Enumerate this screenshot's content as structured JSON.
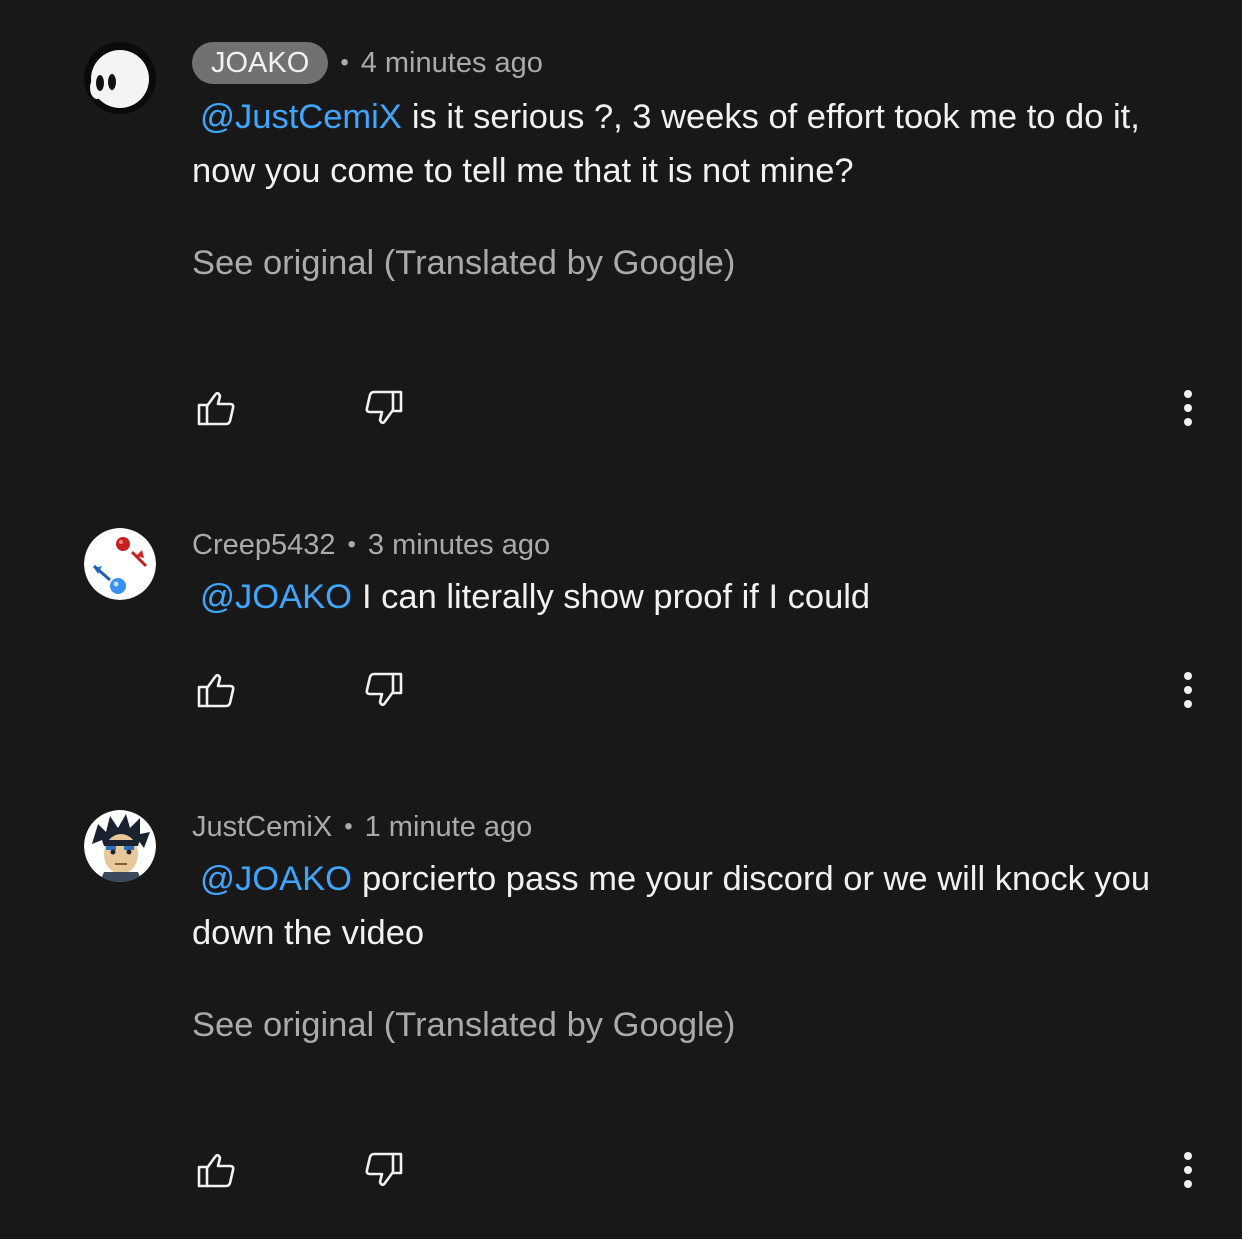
{
  "comments": [
    {
      "author": "JOAKO",
      "author_style": "pill",
      "time": "4 minutes ago",
      "separator": "•",
      "mention": "@JustCemiX",
      "text": "is it serious ?, 3 weeks of effort took me to do it, now you come to tell me that it is not mine?",
      "see_original": "See original (Translated by Google)",
      "avatar_icon": "white-ghost-avatar-icon"
    },
    {
      "author": "Creep5432",
      "author_style": "plain",
      "time": "3 minutes ago",
      "separator": "•",
      "mention": "@JOAKO",
      "text": "I can literally show proof if I could",
      "see_original": "",
      "avatar_icon": "red-blue-figures-avatar-icon"
    },
    {
      "author": "JustCemiX",
      "author_style": "plain",
      "time": "1 minute ago",
      "separator": "•",
      "mention": "@JOAKO",
      "text": "porcierto pass me your discord or we will knock you down the video",
      "see_original": "See original (Translated by Google)",
      "avatar_icon": "anime-character-avatar-icon"
    }
  ],
  "icons": {
    "like": "thumbs-up-icon",
    "dislike": "thumbs-down-icon",
    "more": "more-vertical-icon"
  },
  "colors": {
    "background": "#181818",
    "text": "#f1f1f1",
    "secondary_text": "#aaaaaa",
    "mention": "#3ea6ff",
    "author_pill": "#717171"
  }
}
